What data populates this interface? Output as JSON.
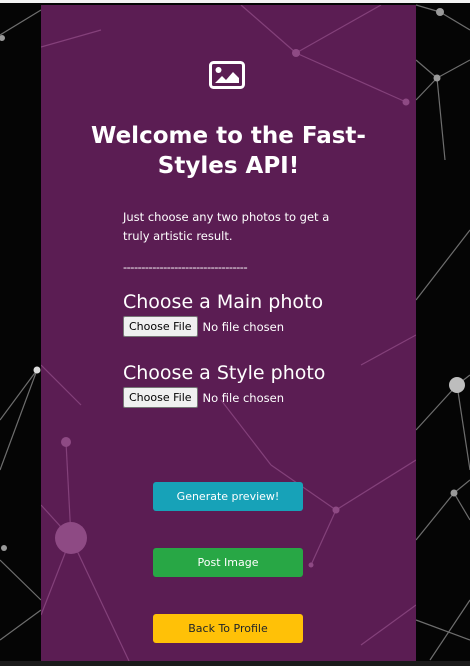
{
  "header": {
    "icon": "image-icon",
    "title": "Welcome to the Fast-Styles API!"
  },
  "intro": {
    "text": "Just choose any two photos to get a truly artistic result.",
    "divider": "----------------------------------"
  },
  "main_photo": {
    "heading": "Choose a Main photo",
    "button_label": "Choose File",
    "status": "No file chosen"
  },
  "style_photo": {
    "heading": "Choose a Style photo",
    "button_label": "Choose File",
    "status": "No file chosen"
  },
  "actions": {
    "generate_label": "Generate preview!",
    "post_label": "Post Image",
    "back_label": "Back To Profile"
  },
  "colors": {
    "card_background": "#5f1e56",
    "page_background": "#050505",
    "generate_button": "#17a2b8",
    "post_button": "#28a745",
    "back_button": "#ffc107"
  }
}
